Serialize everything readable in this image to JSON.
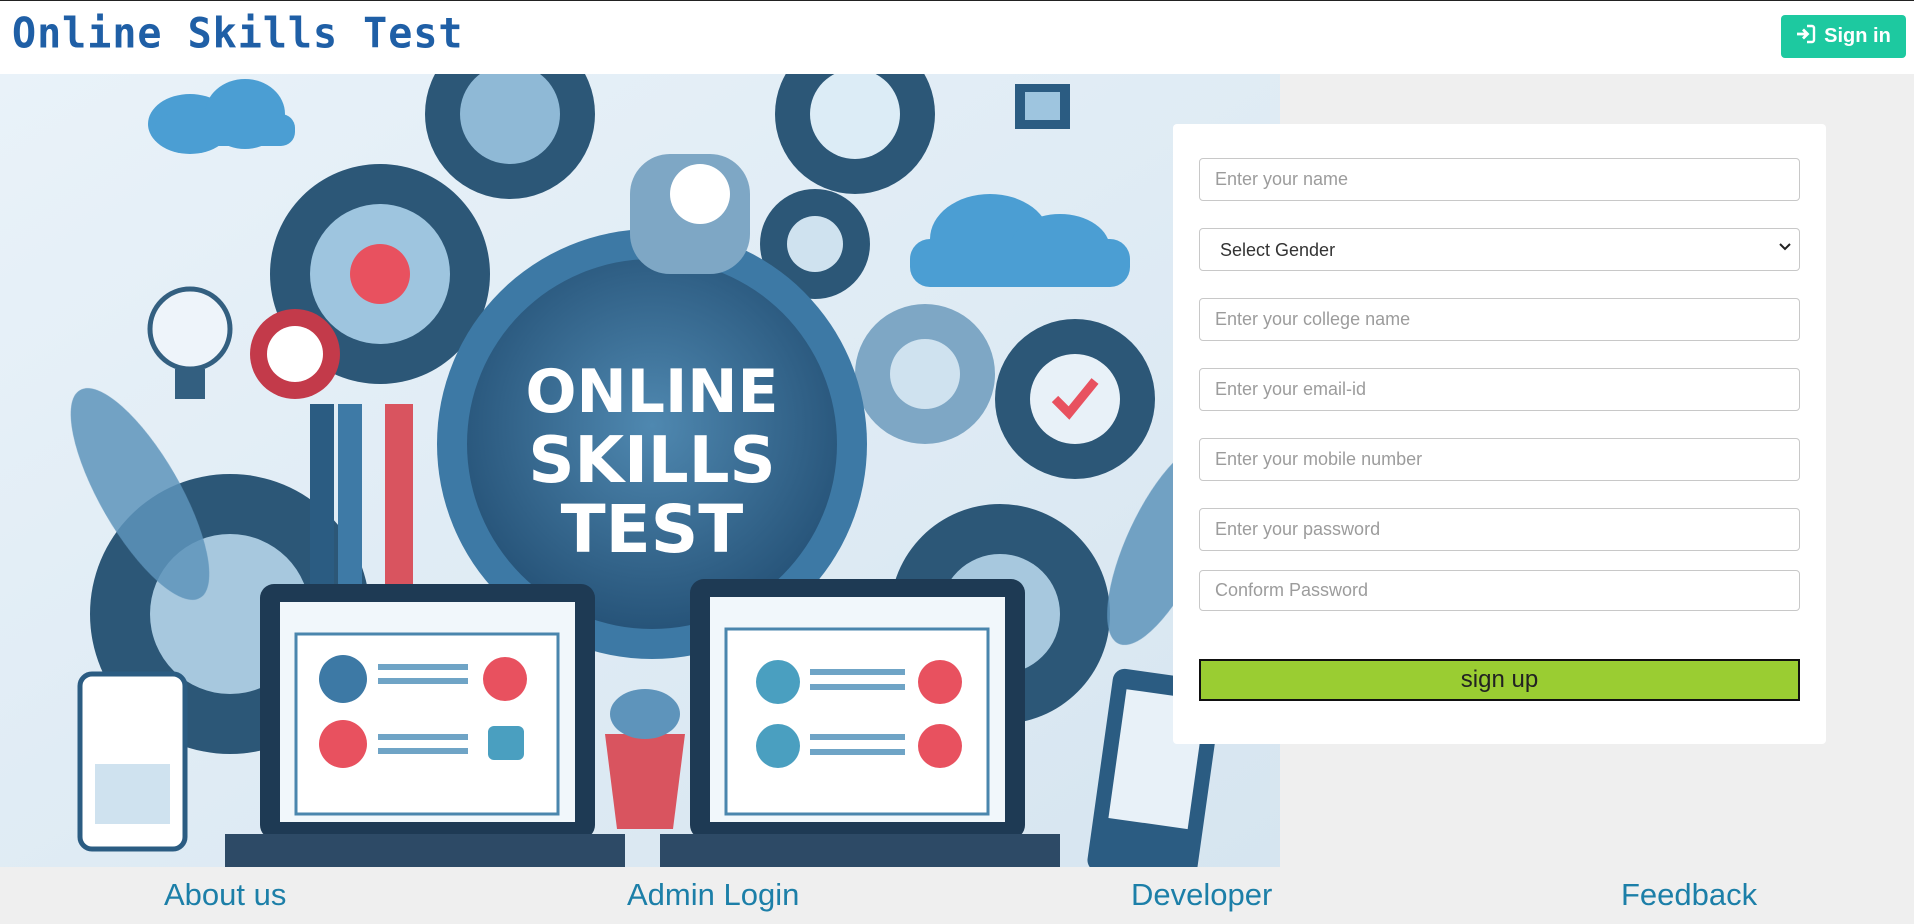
{
  "header": {
    "brand": "Online Skills Test",
    "signin_label": "Sign in"
  },
  "hero": {
    "line1": "ONLINE",
    "line2": "SKILLS",
    "line3": "TEST"
  },
  "form": {
    "name_placeholder": "Enter your name",
    "gender_selected": "Select Gender",
    "college_placeholder": "Enter your college name",
    "email_placeholder": "Enter your email-id",
    "mobile_placeholder": "Enter your mobile number",
    "password_placeholder": "Enter your password",
    "confirm_placeholder": "Conform Password",
    "signup_label": "sign up"
  },
  "footer": {
    "links": [
      "About us",
      "Admin Login",
      "Developer",
      "Feedback"
    ]
  },
  "colors": {
    "brand": "#1f5fa6",
    "signin": "#1dc9a0",
    "signup": "#9acd32",
    "footer_link": "#1c7fa8"
  },
  "icons": {
    "signin": "sign-in-icon",
    "select": "chevron-down-icon"
  }
}
